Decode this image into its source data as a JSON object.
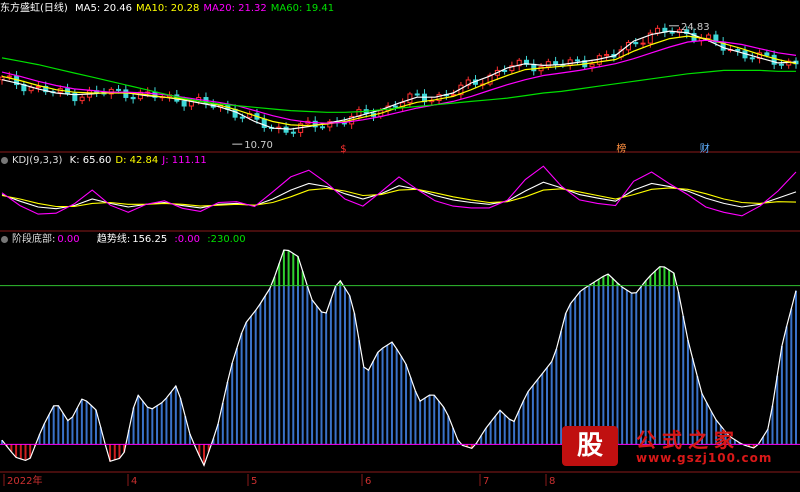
{
  "stock": {
    "name": "东方盛虹",
    "period": "(日线)"
  },
  "price_panel": {
    "ma_labels": [
      {
        "key": "MA5",
        "value": "20.46",
        "color": "#ffffff"
      },
      {
        "key": "MA10",
        "value": "20.28",
        "color": "#ffff00"
      },
      {
        "key": "MA20",
        "value": "21.32",
        "color": "#ff00ff"
      },
      {
        "key": "MA60",
        "value": "19.41",
        "color": "#00e000"
      }
    ],
    "high_annotation": "24.83",
    "low_annotation": "10.70",
    "event_markers": [
      {
        "label": "$",
        "color": "#ff3030"
      },
      {
        "label": "榜",
        "color": "#ff9040"
      },
      {
        "label": "财",
        "color": "#60b0ff"
      }
    ]
  },
  "kdj_panel": {
    "title": "KDJ(9,3,3)",
    "values": [
      {
        "key": "K",
        "value": "65.60",
        "color": "#ffffff"
      },
      {
        "key": "D",
        "value": "42.84",
        "color": "#ffff00"
      },
      {
        "key": "J",
        "value": "111.11",
        "color": "#ff00ff"
      }
    ]
  },
  "custom_panel": {
    "title": "阶段底部",
    "bottom_value": "0.00",
    "trend_label": "趋势线",
    "trend_value": "156.25",
    "extra_values": [
      "0.00",
      "230.00"
    ],
    "extra_colors": [
      "#ff00ff",
      "#00e000"
    ]
  },
  "x_axis": {
    "labels": [
      "2022年",
      "4",
      "5",
      "6",
      "7",
      "8"
    ]
  },
  "watermark": {
    "badge": "股",
    "name": "公式之家",
    "url": "www.gszj100.com"
  },
  "chart_data": [
    {
      "type": "candlestick",
      "title": "",
      "ma_series": [
        {
          "name": "MA5",
          "color": "#ffffff",
          "values": [
            18.4,
            17.9,
            17.3,
            16.8,
            16.6,
            16.7,
            16.9,
            16.8,
            16.5,
            16.3,
            16.0,
            15.6,
            15.2,
            14.5,
            13.4,
            12.6,
            12.5,
            12.8,
            13.2,
            13.6,
            14.2,
            14.8,
            15.6,
            16.3,
            16.3,
            16.8,
            18.0,
            18.8,
            19.8,
            20.3,
            20.1,
            20.2,
            20.5,
            20.8,
            21.3,
            23.0,
            23.8,
            24.2,
            24.0,
            23.2,
            22.2,
            21.6,
            21.0,
            20.4,
            20.5
          ]
        },
        {
          "name": "MA10",
          "color": "#ffff00",
          "values": [
            18.8,
            18.3,
            17.7,
            17.2,
            16.9,
            16.8,
            16.8,
            16.8,
            16.6,
            16.3,
            16.1,
            15.8,
            15.4,
            14.8,
            14.1,
            13.4,
            13.0,
            12.9,
            13.1,
            13.4,
            13.9,
            14.4,
            15.1,
            15.7,
            16.0,
            16.4,
            17.2,
            18.1,
            18.9,
            19.6,
            19.8,
            20.0,
            20.2,
            20.5,
            20.8,
            21.8,
            22.6,
            23.3,
            23.6,
            23.3,
            22.7,
            22.1,
            21.4,
            20.8,
            20.3
          ]
        },
        {
          "name": "MA20",
          "color": "#ff00ff",
          "values": [
            19.3,
            18.8,
            18.2,
            17.7,
            17.3,
            17.1,
            16.9,
            16.9,
            16.8,
            16.6,
            16.3,
            16.0,
            15.7,
            15.3,
            14.7,
            14.1,
            13.6,
            13.3,
            13.2,
            13.3,
            13.6,
            14.0,
            14.5,
            15.0,
            15.4,
            15.8,
            16.4,
            17.1,
            17.8,
            18.4,
            18.9,
            19.2,
            19.5,
            19.9,
            20.3,
            20.9,
            21.6,
            22.3,
            22.9,
            23.1,
            22.9,
            22.6,
            22.1,
            21.6,
            21.3
          ]
        },
        {
          "name": "MA60",
          "color": "#00e000",
          "values": [
            21.0,
            20.6,
            20.2,
            19.7,
            19.2,
            18.7,
            18.2,
            17.7,
            17.2,
            16.7,
            16.2,
            15.8,
            15.5,
            15.3,
            15.1,
            14.9,
            14.7,
            14.6,
            14.5,
            14.5,
            14.6,
            14.8,
            15.0,
            15.2,
            15.4,
            15.6,
            15.8,
            16.0,
            16.2,
            16.5,
            16.8,
            17.0,
            17.3,
            17.6,
            17.9,
            18.2,
            18.5,
            18.8,
            19.1,
            19.3,
            19.5,
            19.5,
            19.5,
            19.4,
            19.4
          ]
        }
      ],
      "ylim": [
        10.0,
        26.0
      ],
      "annotated_high": 24.83,
      "annotated_low": 10.7,
      "event_positions": [
        0.43,
        0.78,
        0.885
      ]
    },
    {
      "type": "line",
      "title": "KDJ(9,3,3)",
      "ylim": [
        -20,
        120
      ],
      "series": [
        {
          "name": "K",
          "color": "#ffffff",
          "values": [
            60,
            45,
            32,
            28,
            35,
            50,
            40,
            32,
            38,
            42,
            35,
            30,
            38,
            40,
            35,
            50,
            70,
            85,
            78,
            62,
            50,
            62,
            80,
            72,
            58,
            48,
            42,
            38,
            45,
            68,
            88,
            75,
            60,
            52,
            45,
            70,
            85,
            78,
            68,
            52,
            40,
            32,
            38,
            52,
            66
          ]
        },
        {
          "name": "D",
          "color": "#ffff00",
          "values": [
            58,
            50,
            40,
            33,
            33,
            40,
            42,
            38,
            38,
            40,
            38,
            34,
            36,
            38,
            36,
            42,
            55,
            70,
            74,
            68,
            58,
            60,
            70,
            72,
            64,
            55,
            48,
            42,
            44,
            55,
            70,
            73,
            66,
            58,
            50,
            60,
            72,
            75,
            72,
            62,
            50,
            42,
            40,
            44,
            43
          ]
        },
        {
          "name": "J",
          "color": "#ff00ff",
          "values": [
            64,
            35,
            16,
            18,
            39,
            70,
            36,
            20,
            38,
            46,
            29,
            22,
            42,
            44,
            33,
            66,
            100,
            115,
            86,
            50,
            34,
            66,
            100,
            72,
            46,
            34,
            30,
            30,
            47,
            94,
            124,
            79,
            48,
            40,
            35,
            90,
            111,
            84,
            60,
            32,
            20,
            12,
            34,
            68,
            111
          ]
        }
      ]
    },
    {
      "type": "bar",
      "title": "阶段底部",
      "ylim": [
        -30,
        230
      ],
      "threshold": 186,
      "baseline": 0,
      "series": [
        {
          "name": "趋势线",
          "color": "#ffffff",
          "values": [
            5,
            -15,
            -20,
            20,
            50,
            25,
            55,
            40,
            -20,
            -15,
            60,
            40,
            50,
            70,
            10,
            -25,
            20,
            90,
            140,
            160,
            185,
            230,
            220,
            170,
            150,
            195,
            170,
            80,
            110,
            120,
            95,
            50,
            60,
            40,
            0,
            -5,
            20,
            40,
            25,
            60,
            80,
            100,
            160,
            180,
            190,
            200,
            185,
            175,
            195,
            210,
            200,
            120,
            60,
            30,
            10,
            0,
            -5,
            20,
            120,
            180
          ]
        }
      ]
    }
  ]
}
